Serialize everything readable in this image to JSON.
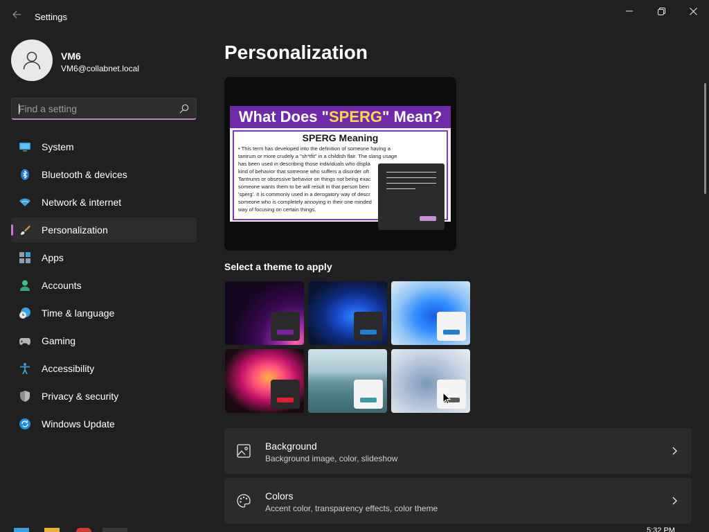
{
  "app": {
    "title": "Settings"
  },
  "window_controls": {
    "minimize": "minimize",
    "maximize": "restore",
    "close": "close"
  },
  "profile": {
    "name": "VM6",
    "email": "VM6@collabnet.local"
  },
  "search": {
    "placeholder": "Find a setting",
    "value": ""
  },
  "sidebar": {
    "active": "Personalization",
    "items": [
      {
        "label": "System",
        "icon": "monitor-icon"
      },
      {
        "label": "Bluetooth & devices",
        "icon": "bluetooth-icon"
      },
      {
        "label": "Network & internet",
        "icon": "wifi-icon"
      },
      {
        "label": "Personalization",
        "icon": "brush-icon"
      },
      {
        "label": "Apps",
        "icon": "apps-icon"
      },
      {
        "label": "Accounts",
        "icon": "person-icon"
      },
      {
        "label": "Time & language",
        "icon": "clock-globe-icon"
      },
      {
        "label": "Gaming",
        "icon": "gamepad-icon"
      },
      {
        "label": "Accessibility",
        "icon": "accessibility-icon"
      },
      {
        "label": "Privacy & security",
        "icon": "shield-icon"
      },
      {
        "label": "Windows Update",
        "icon": "update-icon"
      }
    ]
  },
  "main": {
    "title": "Personalization",
    "preview": {
      "headline_prefix": "What Does \"",
      "headline_highlight": "SPERG",
      "headline_suffix": "\" Mean?",
      "subheading": "SPERG Meaning",
      "body_lines": [
        "• This term has developed into the definition of someone having a",
        "tantrum or more crudely a \"sh*tfit\" in a childish flair. The slang usage",
        "has been used in describing those individuals who displa",
        "kind of behavior that someone who suffers a disorder oft",
        "Tantrums or obsessive behavior on things not being exac",
        "someone wants them to be will result in that person bein",
        "'sperg'. It is commonly used in a derogatory way of descr",
        "someone who is completely annoying in their one minded",
        "way of focusing on certain things."
      ]
    },
    "themes_heading": "Select a theme to apply",
    "themes": [
      {
        "name": "glow-dark",
        "accent": "#7a1fa2"
      },
      {
        "name": "bloom-dark",
        "accent": "#1f7ed1"
      },
      {
        "name": "bloom-light",
        "accent": "#1f7ed1"
      },
      {
        "name": "captured-motion",
        "accent": "#e01e2e"
      },
      {
        "name": "sunrise-lake",
        "accent": "#3a9aa8"
      },
      {
        "name": "flow",
        "accent": "#5a5a5a"
      }
    ],
    "cards": [
      {
        "title": "Background",
        "subtitle": "Background image, color, slideshow",
        "icon": "picture-icon"
      },
      {
        "title": "Colors",
        "subtitle": "Accent color, transparency effects, color theme",
        "icon": "palette-icon"
      }
    ]
  },
  "taskbar": {
    "time": "5:32 PM"
  },
  "colors": {
    "accent": "#c67bd1",
    "background": "#202020",
    "card": "#2b2b2b"
  }
}
